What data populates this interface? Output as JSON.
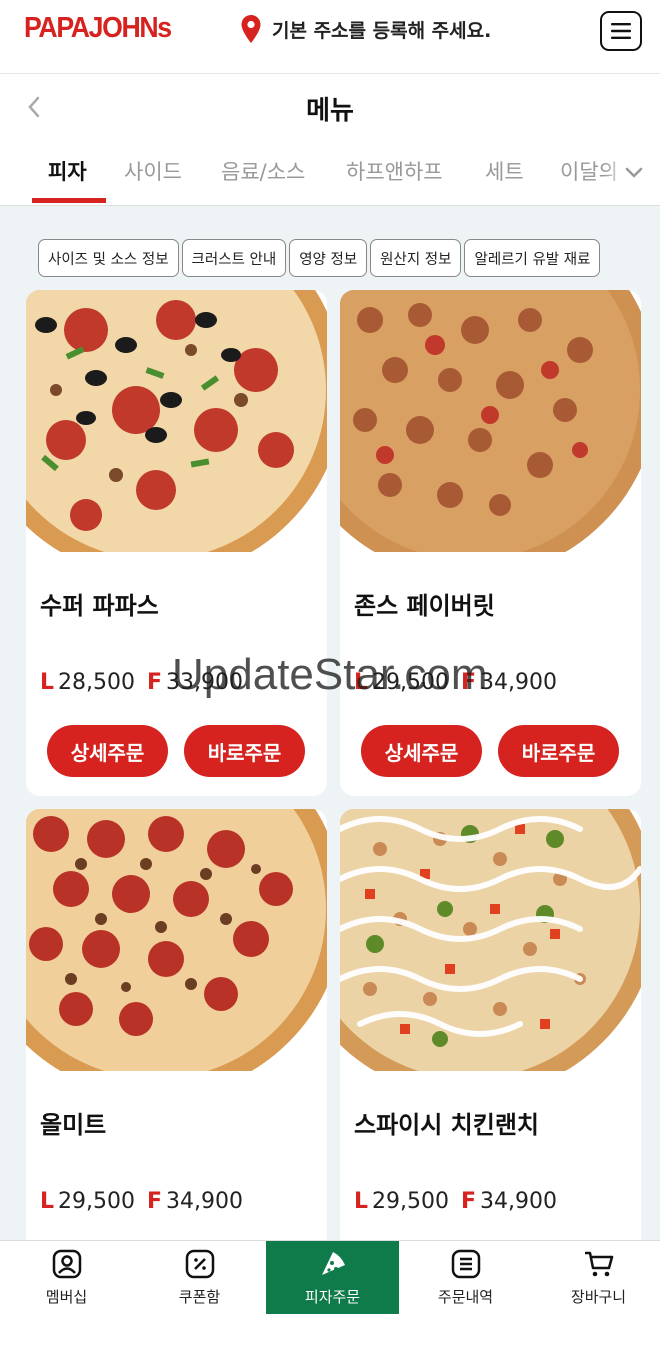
{
  "header": {
    "logo_text": "PAPAJOHNs",
    "address_text": "기본 주소를 등록해 주세요.",
    "brand_color": "#d6231f"
  },
  "titlebar": {
    "title": "메뉴"
  },
  "tabs": [
    {
      "label": "피자",
      "active": true
    },
    {
      "label": "사이드",
      "active": false
    },
    {
      "label": "음료/소스",
      "active": false
    },
    {
      "label": "하프앤하프",
      "active": false
    },
    {
      "label": "세트",
      "active": false
    },
    {
      "label": "이달의",
      "active": false
    }
  ],
  "chips": [
    "사이즈 및 소스 정보",
    "크러스트 안내",
    "영양 정보",
    "원산지 정보",
    "알레르기 유발 재료"
  ],
  "products": [
    {
      "name": "수퍼 파파스",
      "size_l": "L",
      "price_l": "28,500",
      "size_f": "F",
      "price_f": "33,900",
      "detail_label": "상세주문",
      "order_label": "바로주문"
    },
    {
      "name": "존스 페이버릿",
      "size_l": "L",
      "price_l": "29,500",
      "size_f": "F",
      "price_f": "34,900",
      "detail_label": "상세주문",
      "order_label": "바로주문"
    },
    {
      "name": "올미트",
      "size_l": "L",
      "price_l": "29,500",
      "size_f": "F",
      "price_f": "34,900"
    },
    {
      "name": "스파이시 치킨랜치",
      "size_l": "L",
      "price_l": "29,500",
      "size_f": "F",
      "price_f": "34,900"
    }
  ],
  "watermark": "UpdateStar.com",
  "bottom_nav": [
    {
      "label": "멤버십",
      "icon": "member-icon"
    },
    {
      "label": "쿠폰함",
      "icon": "coupon-icon"
    },
    {
      "label": "피자주문",
      "icon": "pizza-slice-icon",
      "active": true
    },
    {
      "label": "주문내역",
      "icon": "order-history-icon"
    },
    {
      "label": "장바구니",
      "icon": "cart-icon"
    }
  ],
  "nav_active_color": "#0f7a4a"
}
